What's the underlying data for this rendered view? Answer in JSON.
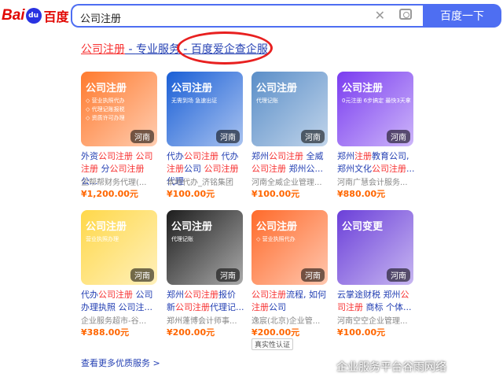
{
  "logo": {
    "bai": "Bai",
    "du": "du",
    "cn": "百度"
  },
  "search": {
    "query": "公司注册",
    "button_label": "百度一下"
  },
  "result": {
    "title_part1": "公司注册",
    "sep1": " - ",
    "title_part2": "专业服务",
    "sep2": " - ",
    "title_part3": "百度爱企查企服"
  },
  "products": [
    {
      "thumb_title": "公司注册",
      "thumb_sub": "◇ 营业执照代办\n◇ 代理记账报税\n◇ 资质许可办理",
      "region": "河南",
      "name_html": [
        "外资",
        "公司注册",
        " ",
        "公司注册",
        "分",
        "公司注册",
        "公..."
      ],
      "name": "外资公司注册 公司注册 分公司注册 公...",
      "shop": "企帮帮财务代理(...",
      "price": "¥1,200.00元",
      "bg": "#ff7a2e"
    },
    {
      "thumb_title": "公司注册",
      "thumb_sub": "无需到场 急速出证",
      "region": "河南",
      "name": "代办公司注册 代办注册公司 公司注册代理",
      "shop": "本地代办_济铭集团",
      "price": "¥100.00元",
      "bg": "#1a5fd6"
    },
    {
      "thumb_title": "公司注册",
      "thumb_sub": "代理记账",
      "region": "河南",
      "name": "郑州公司注册 全威公司注册 郑州公...",
      "shop": "河南全威企业管理...",
      "price": "¥100.00元",
      "bg": "#5a8ec8"
    },
    {
      "thumb_title": "公司注册",
      "thumb_sub": "0元注册 6步搞定 最快3天拿",
      "region": "河南",
      "name": "郑州注册教育公司, 郑州文化公司注册...",
      "shop": "河南广慧会计服务...",
      "price": "¥880.00元",
      "bg": "#7a3cf0"
    },
    {
      "thumb_title": "公司注册",
      "thumb_sub": "营业执照办理",
      "region": "河南",
      "name": "代办公司注册 公司办理执照 公司注...",
      "shop": "企业服务超市-谷...",
      "price": "¥388.00元",
      "bg": "#ffd84a"
    },
    {
      "thumb_title": "公司注册",
      "thumb_sub": "代理记账",
      "region": "河南",
      "name": "郑州公司注册报价 新公司注册代理记...",
      "shop": "郑州蓬博会计师事...",
      "price": "¥200.00元",
      "bg": "#1d1d1d"
    },
    {
      "thumb_title": "公司注册",
      "thumb_sub": "◇ 营业执照代办",
      "region": "河南",
      "name": "公司注册流程, 如何注册公司",
      "shop": "逸宸(北京)企业管...",
      "price": "¥200.00元",
      "verify": "真实性认证",
      "bg": "#ff6a2a"
    },
    {
      "thumb_title": "公司变更",
      "thumb_sub": "",
      "region": "河南",
      "name": "云掌途财税 郑州公司注册 商标 个体...",
      "shop": "河南空空企业管理...",
      "price": "¥100.00元",
      "bg": "#6b3fd9"
    }
  ],
  "more_link": "查看更多优质服务 >",
  "watermark": "企业服务平台谷雨网络"
}
